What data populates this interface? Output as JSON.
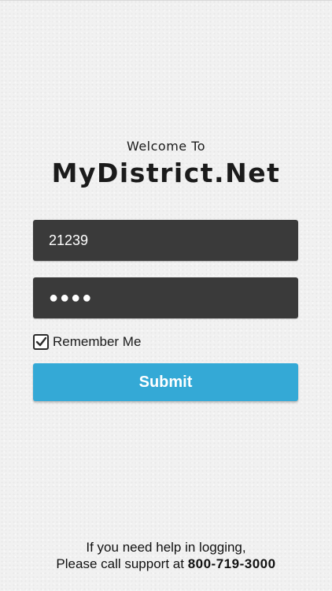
{
  "header": {
    "welcome": "Welcome To",
    "title": "MyDistrict.Net"
  },
  "form": {
    "username_value": "21239",
    "password_masked": "●●●●",
    "remember_label": "Remember Me",
    "remember_checked": true,
    "submit_label": "Submit"
  },
  "footer": {
    "line1": "If you need help in logging,",
    "line2_prefix": "Please call support at ",
    "phone": "800-719-3000"
  },
  "colors": {
    "field_bg": "#3a3a3a",
    "submit_bg": "#34a9d6"
  }
}
